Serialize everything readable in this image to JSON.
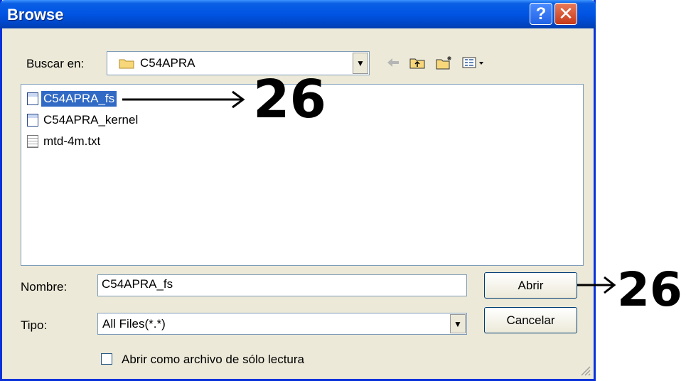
{
  "window": {
    "title": "Browse",
    "help_glyph": "?",
    "close_glyph": "✕"
  },
  "look_in": {
    "label": "Buscar en:",
    "value": "C54APRA"
  },
  "toolbar": {
    "back_icon": "back-arrow-icon",
    "up_icon": "up-folder-icon",
    "new_folder_icon": "new-folder-icon",
    "view_icon": "view-menu-icon"
  },
  "files": [
    {
      "name": "C54APRA_fs",
      "icon": "binary-file-icon",
      "selected": true
    },
    {
      "name": "C54APRA_kernel",
      "icon": "binary-file-icon",
      "selected": false
    },
    {
      "name": "mtd-4m.txt",
      "icon": "text-file-icon",
      "selected": false
    }
  ],
  "filename": {
    "label": "Nombre:",
    "value": "C54APRA_fs"
  },
  "filetype": {
    "label": "Tipo:",
    "value": "All Files(*.*)"
  },
  "buttons": {
    "open": "Abrir",
    "cancel": "Cancelar"
  },
  "readonly": {
    "label": "Abrir como archivo de sólo lectura",
    "checked": false
  },
  "annotations": {
    "file_callout": "26",
    "button_callout": "26"
  },
  "colors": {
    "titlebar": "#0054e3",
    "selection": "#316ac5",
    "dialog_bg": "#ece9d8"
  }
}
